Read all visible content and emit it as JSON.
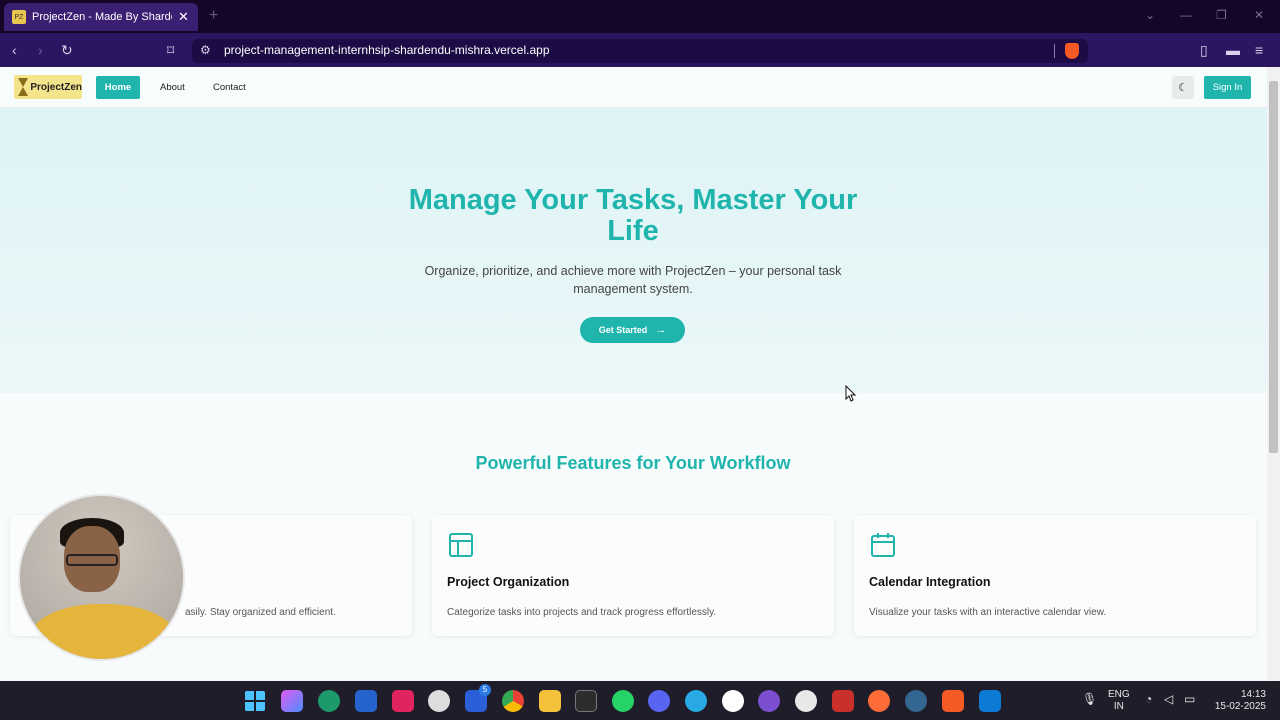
{
  "browser": {
    "tab_title": "ProjectZen - Made By Shardendu",
    "tab_close": "✕",
    "new_tab": "+",
    "url": "project-management-internhsip-shardendu-mishra.vercel.app"
  },
  "nav": {
    "logo_text": "ProjectZen",
    "links": [
      "Home",
      "About",
      "Contact"
    ],
    "theme_toggle_icon": "moon-icon",
    "signin_label": "Sign In"
  },
  "hero": {
    "title": "Manage Your Tasks, Master Your Life",
    "subtitle": "Organize, prioritize, and achieve more with ProjectZen – your personal task management system.",
    "cta_label": "Get Started",
    "cta_arrow": "→"
  },
  "features": {
    "title": "Powerful Features for Your Workflow",
    "cards": [
      {
        "icon": "task-icon",
        "title": "",
        "desc": "asily. Stay organized and efficient."
      },
      {
        "icon": "layout-icon",
        "title": "Project Organization",
        "desc": "Categorize tasks into projects and track progress effortlessly."
      },
      {
        "icon": "calendar-icon",
        "title": "Calendar Integration",
        "desc": "Visualize your tasks with an interactive calendar view."
      }
    ]
  },
  "taskbar": {
    "lang_top": "ENG",
    "lang_bottom": "IN",
    "time": "14:13",
    "date": "15-02-2025",
    "badge": "5"
  },
  "colors": {
    "accent": "#1fb5ad",
    "browser_toolbar": "#2c1561"
  }
}
